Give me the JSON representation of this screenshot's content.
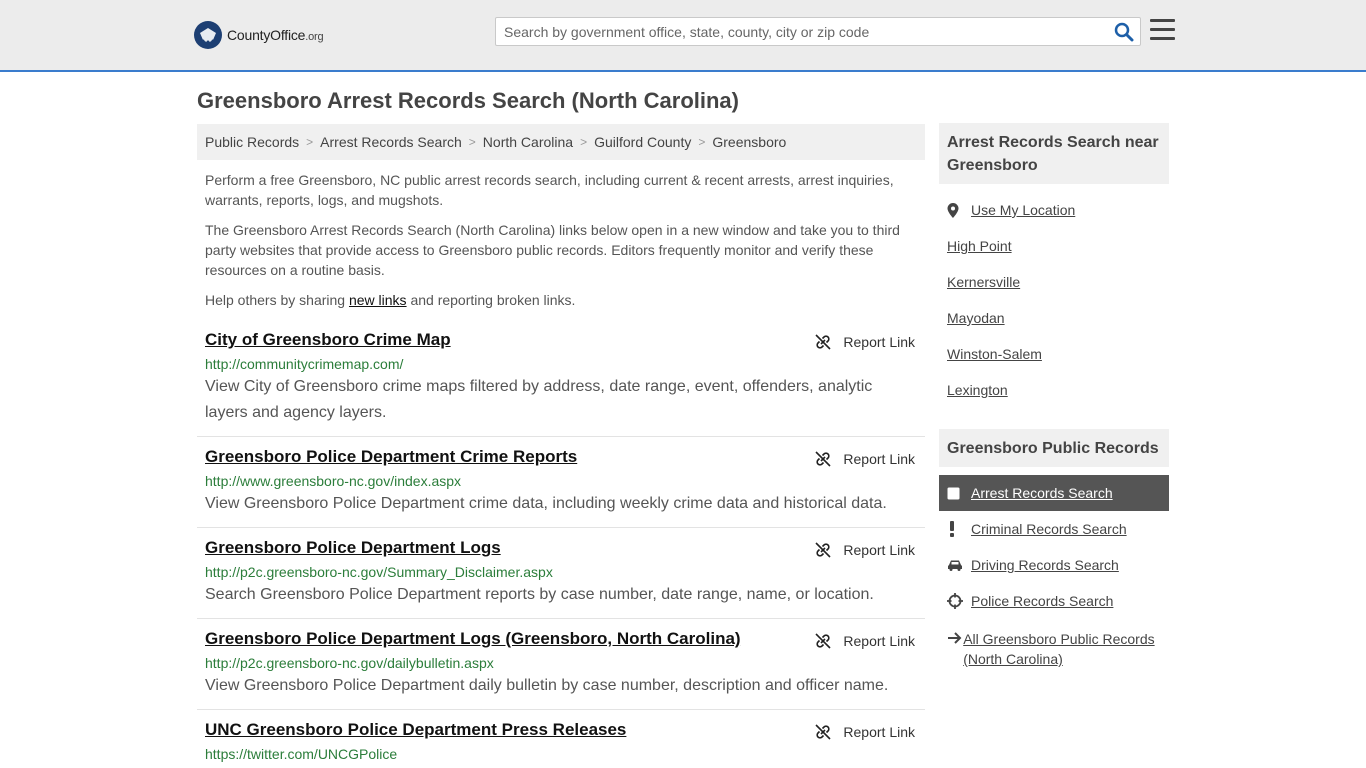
{
  "header": {
    "logo_main": "CountyOffice",
    "logo_tld": ".org",
    "search_placeholder": "Search by government office, state, county, city or zip code"
  },
  "page_title": "Greensboro Arrest Records Search (North Carolina)",
  "breadcrumb": [
    "Public Records",
    "Arrest Records Search",
    "North Carolina",
    "Guilford County",
    "Greensboro"
  ],
  "intro": {
    "p1": "Perform a free Greensboro, NC public arrest records search, including current & recent arrests, arrest inquiries, warrants, reports, logs, and mugshots.",
    "p2": "The Greensboro Arrest Records Search (North Carolina) links below open in a new window and take you to third party websites that provide access to Greensboro public records. Editors frequently monitor and verify these resources on a routine basis.",
    "p3_before": "Help others by sharing ",
    "p3_link": "new links",
    "p3_after": " and reporting broken links."
  },
  "report_label": "Report Link",
  "results": [
    {
      "title": "City of Greensboro Crime Map",
      "url": "http://communitycrimemap.com/",
      "desc": "View City of Greensboro crime maps filtered by address, date range, event, offenders, analytic layers and agency layers."
    },
    {
      "title": "Greensboro Police Department Crime Reports",
      "url": "http://www.greensboro-nc.gov/index.aspx",
      "desc": "View Greensboro Police Department crime data, including weekly crime data and historical data."
    },
    {
      "title": "Greensboro Police Department Logs",
      "url": "http://p2c.greensboro-nc.gov/Summary_Disclaimer.aspx",
      "desc": "Search Greensboro Police Department reports by case number, date range, name, or location."
    },
    {
      "title": "Greensboro Police Department Logs (Greensboro, North Carolina)",
      "url": "http://p2c.greensboro-nc.gov/dailybulletin.aspx",
      "desc": "View Greensboro Police Department daily bulletin by case number, description and officer name."
    },
    {
      "title": "UNC Greensboro Police Department Press Releases",
      "url": "https://twitter.com/UNCGPolice",
      "desc": ""
    }
  ],
  "sidebar": {
    "nearby_title": "Arrest Records Search near Greensboro",
    "use_location": "Use My Location",
    "nearby": [
      "High Point",
      "Kernersville",
      "Mayodan",
      "Winston-Salem",
      "Lexington"
    ],
    "records_title": "Greensboro Public Records",
    "records": [
      {
        "label": "Arrest Records Search",
        "icon": "square-icon",
        "active": true
      },
      {
        "label": "Criminal Records Search",
        "icon": "exclamation-icon",
        "active": false
      },
      {
        "label": "Driving Records Search",
        "icon": "car-icon",
        "active": false
      },
      {
        "label": "Police Records Search",
        "icon": "crosshair-icon",
        "active": false
      }
    ],
    "all_records": "All Greensboro Public Records (North Carolina)"
  },
  "colors": {
    "accent": "#3a7ccd",
    "url_green": "#2b7d3a",
    "active_bg": "#555555"
  }
}
